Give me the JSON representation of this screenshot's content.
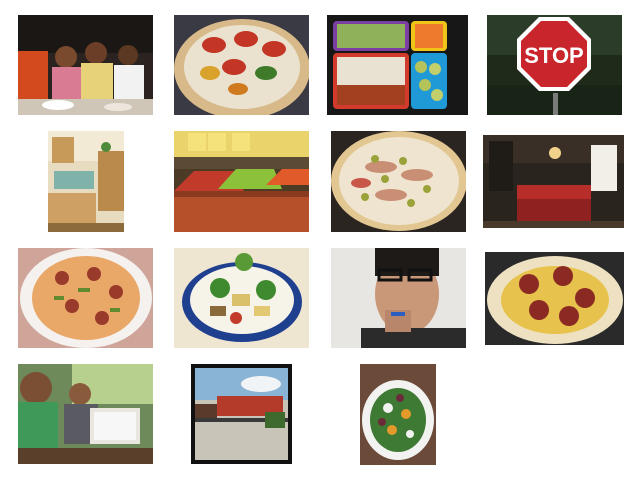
{
  "gallery": {
    "tiles": [
      {
        "subject": "group-photo-restaurant",
        "text": ""
      },
      {
        "subject": "vegetable-pizza",
        "text": ""
      },
      {
        "subject": "bento-lunchbox",
        "text": ""
      },
      {
        "subject": "stop-sign",
        "text": "STOP"
      },
      {
        "subject": "kitchen-interior",
        "text": ""
      },
      {
        "subject": "produce-market",
        "text": ""
      },
      {
        "subject": "olive-pizza",
        "text": ""
      },
      {
        "subject": "dark-kitchen-island",
        "text": ""
      },
      {
        "subject": "sausage-pizza-plate",
        "text": ""
      },
      {
        "subject": "vegetable-stir-fry-bowl",
        "text": ""
      },
      {
        "subject": "man-with-glasses-toothbrush",
        "text": ""
      },
      {
        "subject": "pepperoni-tortilla-pizza",
        "text": ""
      },
      {
        "subject": "men-at-laptop",
        "text": ""
      },
      {
        "subject": "freight-train",
        "text": ""
      },
      {
        "subject": "salad-plate",
        "text": ""
      }
    ]
  },
  "colors": {
    "background": "#ffffff",
    "stop_red": "#c8252c"
  }
}
